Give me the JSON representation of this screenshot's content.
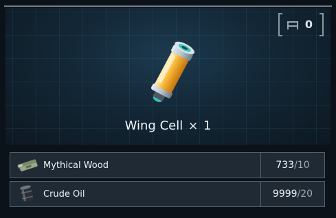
{
  "counter": {
    "icon": "bed-icon",
    "value": "0"
  },
  "item": {
    "name": "Wing Cell",
    "times": "×",
    "quantity": "1",
    "icon": "battery-cell-icon"
  },
  "materials": [
    {
      "name": "Mythical Wood",
      "icon": "wood-icon",
      "have": "733",
      "separator": "/",
      "need": "10"
    },
    {
      "name": "Crude Oil",
      "icon": "oil-barrel-icon",
      "have": "9999",
      "separator": "/",
      "need": "20"
    }
  ],
  "colors": {
    "accent": "#35c7c0",
    "fluid": "#f2a21c",
    "panel": "#132736"
  }
}
